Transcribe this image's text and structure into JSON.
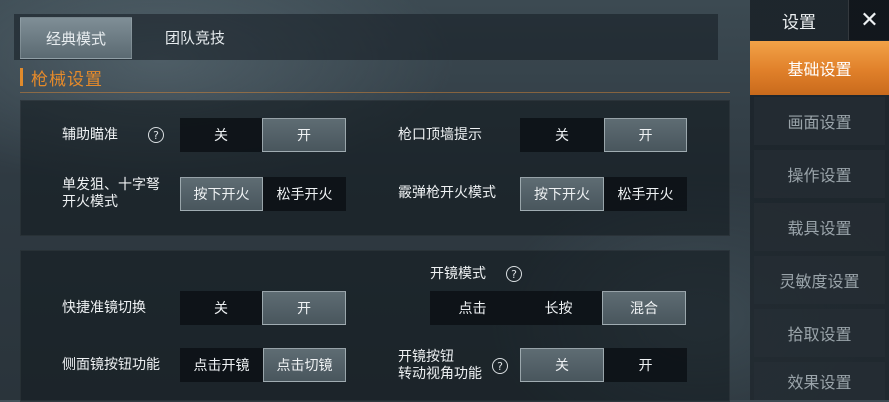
{
  "tabs": [
    {
      "label": "经典模式",
      "active": true
    },
    {
      "label": "团队竞技",
      "active": false
    }
  ],
  "section_title": "枪械设置",
  "accent_color": "#e58a2a",
  "help_glyph": "?",
  "rows": {
    "aim_assist": {
      "label": "辅助瞄准",
      "options": [
        "关",
        "开"
      ],
      "selected": "开"
    },
    "muzzle_hint": {
      "label": "枪口顶墙提示",
      "options": [
        "关",
        "开"
      ],
      "selected": "开"
    },
    "single_fire": {
      "label_line1": "单发狙、十字弩",
      "label_line2": "开火模式",
      "options": [
        "按下开火",
        "松手开火"
      ],
      "selected": "按下开火"
    },
    "shotgun_fire": {
      "label": "霰弹枪开火模式",
      "options": [
        "按下开火",
        "松手开火"
      ],
      "selected": "按下开火"
    },
    "scope_mode": {
      "label": "开镜模式",
      "options": [
        "点击",
        "长按",
        "混合"
      ],
      "selected": "混合"
    },
    "quick_scope": {
      "label": "快捷准镜切换",
      "options": [
        "关",
        "开"
      ],
      "selected": "开"
    },
    "side_scope": {
      "label": "侧面镜按钮功能",
      "options": [
        "点击开镜",
        "点击切镜"
      ],
      "selected": "点击切镜"
    },
    "scope_rotate": {
      "label_line1": "开镜按钮",
      "label_line2": "转动视角功能",
      "options": [
        "关",
        "开"
      ],
      "selected": "关"
    }
  },
  "sidebar": {
    "title": "设置",
    "close_glyph": "✕",
    "items": [
      {
        "label": "基础设置",
        "active": true
      },
      {
        "label": "画面设置",
        "active": false
      },
      {
        "label": "操作设置",
        "active": false
      },
      {
        "label": "载具设置",
        "active": false
      },
      {
        "label": "灵敏度设置",
        "active": false
      },
      {
        "label": "拾取设置",
        "active": false
      },
      {
        "label": "效果设置",
        "active": false
      }
    ]
  }
}
